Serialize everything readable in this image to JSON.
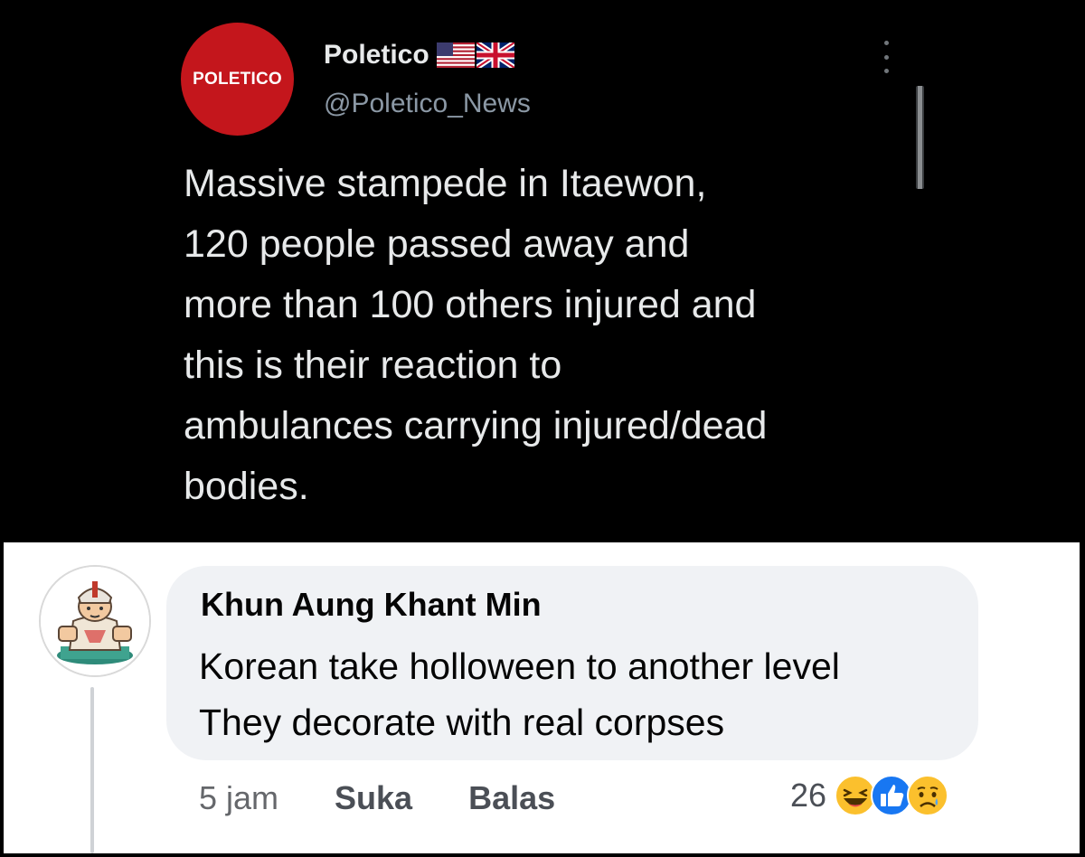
{
  "tweet": {
    "avatar_text": "POLETICO",
    "display_name": "Poletico",
    "handle": "@Poletico_News",
    "text": "Massive stampede in Itaewon,\n120 people passed away and\nmore than 100 others injured and\nthis is their reaction to\nambulances carrying injured/dead\nbodies.",
    "flags": [
      "us-flag-icon",
      "uk-flag-icon"
    ],
    "menu_icon": "more-vertical-icon",
    "colors": {
      "avatar_bg": "#c4161c",
      "background": "#000000",
      "text": "#e7e9ea",
      "handle": "#8b98a5"
    }
  },
  "comment": {
    "author": "Khun Aung Khant Min",
    "text": "Korean take holloween to another level\nThey decorate with real corpses",
    "time": "5 jam",
    "like_label": "Suka",
    "reply_label": "Balas",
    "reaction_count": "26",
    "reaction_icons": [
      "haha-icon",
      "like-icon",
      "sad-icon"
    ],
    "colors": {
      "bubble": "#f0f2f5",
      "text": "#050505",
      "meta": "#65676b",
      "like_blue": "#1877f2"
    }
  }
}
